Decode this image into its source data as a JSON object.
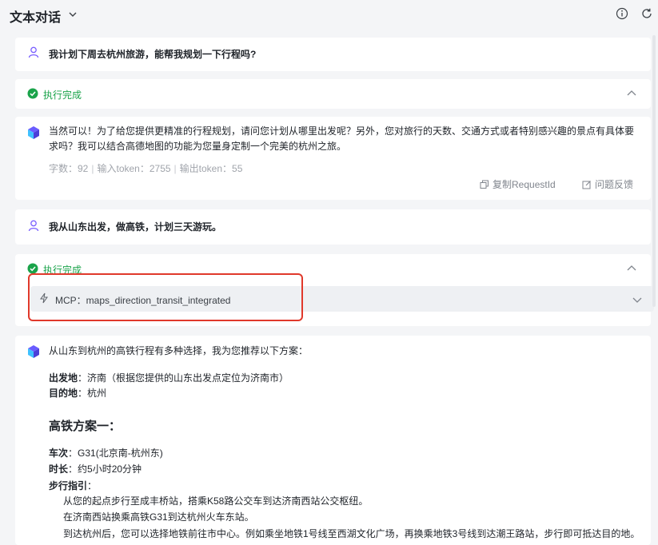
{
  "header": {
    "title": "文本对话",
    "info_icon": "info-icon",
    "refresh_icon": "refresh-icon"
  },
  "messages": {
    "user1": {
      "text": "我计划下周去杭州旅游，能帮我规划一下行程吗?"
    },
    "status1": {
      "text": "执行完成"
    },
    "bot1": {
      "text": "当然可以！为了给您提供更精准的行程规划，请问您计划从哪里出发呢？另外，您对旅行的天数、交通方式或者特别感兴趣的景点有具体要求吗？我可以结合高德地图的功能为您量身定制一个完美的杭州之旅。",
      "meta": {
        "chars": "字数：92",
        "input_tokens": "输入token：2755",
        "output_tokens": "输出token：55"
      },
      "copy_label": "复制RequestId",
      "feedback_label": "问题反馈"
    },
    "user2": {
      "text": "我从山东出发，做高铁，计划三天游玩。"
    },
    "status2": {
      "text": "执行完成",
      "mcp_label": "MCP：maps_direction_transit_integrated"
    },
    "bot2": {
      "intro": "从山东到杭州的高铁行程有多种选择，我为您推荐以下方案：",
      "depart_label": "出发地",
      "depart_value": "：济南（根据您提供的山东出发点定位为济南市）",
      "dest_label": "目的地",
      "dest_value": "：杭州",
      "plan_title": "高铁方案一：",
      "train_label": "车次",
      "train_value": "：G31(北京南-杭州东)",
      "duration_label": "时长",
      "duration_value": "：约5小时20分钟",
      "walk_label": "步行指引",
      "walk_suffix": "：",
      "steps": [
        "从您的起点步行至成丰桥站，搭乘K58路公交车到达济南西站公交枢纽。",
        "在济南西站换乘高铁G31到达杭州火车东站。",
        "到达杭州后，您可以选择地铁前往市中心。例如乘坐地铁1号线至西湖文化广场，再换乘地铁3号线到达潮王路站，步行即可抵达目的地。"
      ]
    }
  },
  "colors": {
    "success": "#1aa34a",
    "highlight": "#e0392b",
    "user_icon": "#7b61ff"
  }
}
